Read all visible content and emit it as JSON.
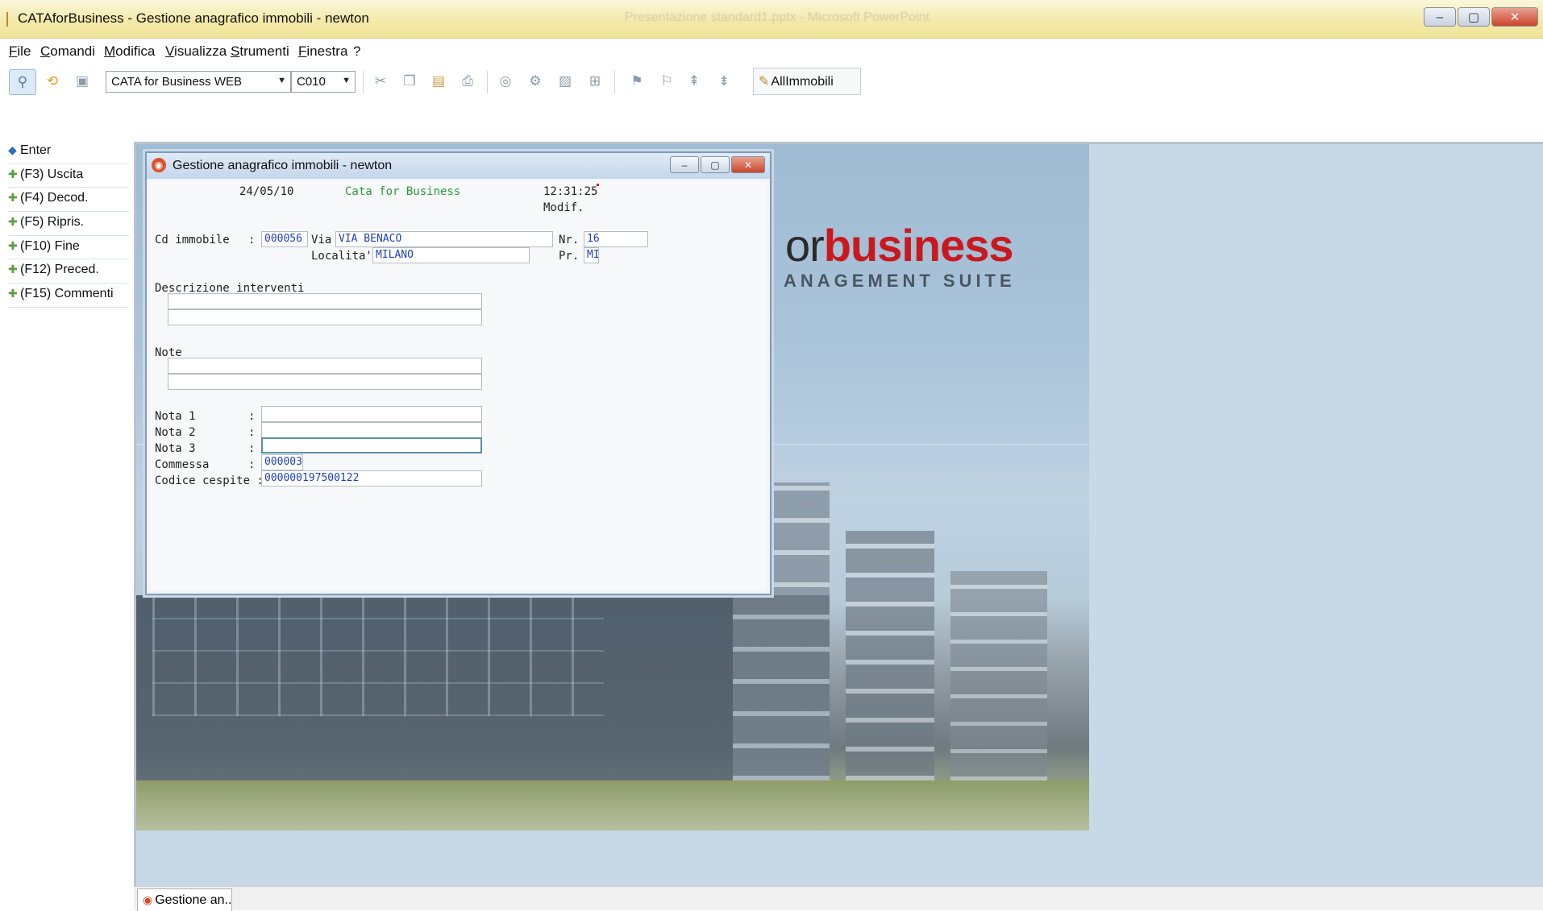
{
  "window": {
    "title": "CATAforBusiness - Gestione anagrafico immobili   -  newton",
    "ghost_title": "Presentazione standard1.pptx - Microsoft PowerPoint",
    "controls": {
      "minimize": "–",
      "maximize": "▢",
      "close": "✕"
    }
  },
  "menu": [
    "File",
    "Comandi",
    "Modifica",
    "Visualizza",
    "Strumenti",
    "Finestra",
    "?"
  ],
  "toolbar": {
    "environment_combo": "CATA for Business WEB",
    "company_combo": "C010",
    "combo_arrow": "▼",
    "allimmobili_label": "AllImmobili",
    "icons": [
      "link-icon",
      "undo-icon",
      "page-icon",
      "scissors-icon",
      "copy-icon",
      "paste-icon",
      "print-icon",
      "preview-icon",
      "settings-icon",
      "image-icon",
      "network-icon",
      "tool-a-icon",
      "tool-b-icon",
      "tool-c-icon",
      "tool-d-icon"
    ]
  },
  "fkeys": [
    "Enter",
    "(F3) Uscita",
    "(F4) Decod.",
    "(F5) Ripris.",
    "(F10) Fine",
    "(F12) Preced.",
    "(F15) Commenti"
  ],
  "background": {
    "logo_pre": "or",
    "logo_main": "business",
    "logo_suite": "ANAGEMENT SUITE"
  },
  "child": {
    "title": "Gestione anagrafico immobili   -  newton",
    "controls": {
      "minimize": "–",
      "maximize": "▢",
      "close": "✕"
    },
    "header": {
      "date": "24/05/10",
      "app": "Cata for Business",
      "time": "12:31:25",
      "mode": "Modif."
    },
    "labels": {
      "cd_immobile": "Cd immobile",
      "colon": ":",
      "via": "Via",
      "nr": "Nr.",
      "localita": "Localita'",
      "pr": "Pr.",
      "descrizione": "Descrizione interventi",
      "note": "Note",
      "nota1": "Nota 1",
      "nota2": "Nota 2",
      "nota3": "Nota 3",
      "commessa": "Commessa",
      "codice_cespite": "Codice cespite :"
    },
    "values": {
      "cd_immobile": "000056",
      "via": "VIA BENACO",
      "nr": "16",
      "localita": "MILANO",
      "pr": "MI",
      "descrizione_1": "",
      "descrizione_2": "",
      "note_1": "",
      "note_2": "",
      "nota1": "",
      "nota2": "",
      "nota3": "",
      "commessa": "000003",
      "codice_cespite": "000000197500122"
    }
  },
  "taskbar": {
    "tab_label": "Gestione an..."
  }
}
